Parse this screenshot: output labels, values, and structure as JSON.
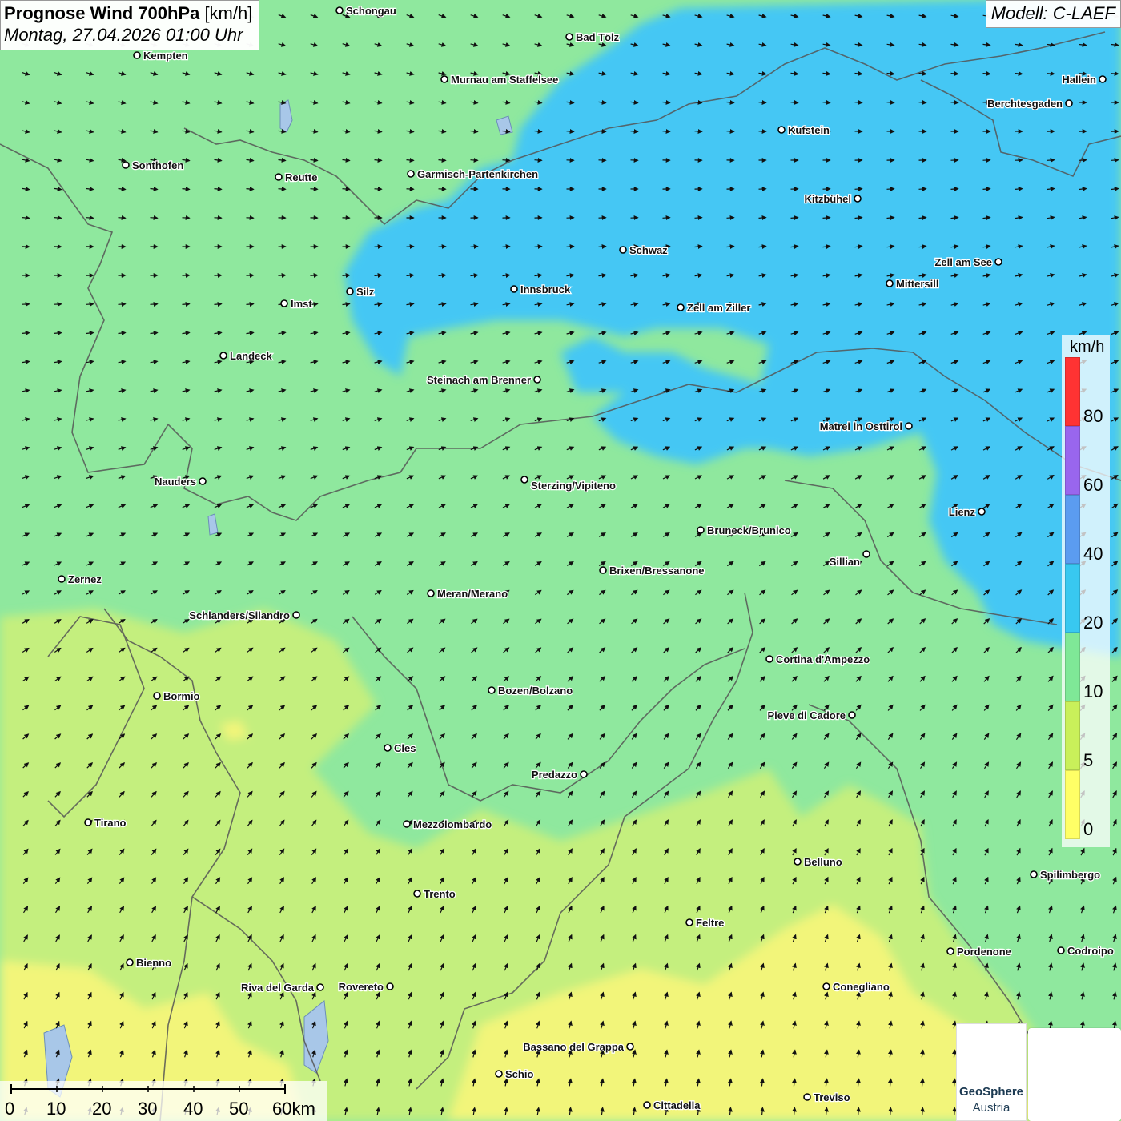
{
  "header": {
    "title_bold": "Prognose Wind 700hPa",
    "title_unit": "[km/h]",
    "datetime": "Montag, 27.04.2026 01:00 Uhr"
  },
  "model_label": "Modell: C-LAEF",
  "legend": {
    "unit": "km/h",
    "labels": [
      "80",
      "60",
      "40",
      "20",
      "10",
      "5",
      "0"
    ],
    "colors": [
      "#ff3333",
      "#9966ee",
      "#5b9cf0",
      "#38c8f0",
      "#7fe897",
      "#c9f05a",
      "#ffff66"
    ]
  },
  "scale": {
    "labels": [
      "0",
      "10",
      "20",
      "30",
      "40",
      "50",
      "60km"
    ]
  },
  "logo": {
    "name1": "GeoSphere",
    "name2": "Austria",
    "icon": "geosphere-logo-icon",
    "app_icon": "wetter-app-icon"
  },
  "places": [
    {
      "name": "Schongau"
    },
    {
      "name": "Bad Tölz"
    },
    {
      "name": "Kempten"
    },
    {
      "name": "Murnau am Staffelsee"
    },
    {
      "name": "Hallein"
    },
    {
      "name": "Berchtesgaden"
    },
    {
      "name": "Kufstein"
    },
    {
      "name": "Sonthofen"
    },
    {
      "name": "Reutte"
    },
    {
      "name": "Garmisch-Partenkirchen"
    },
    {
      "name": "Kitzbühel"
    },
    {
      "name": "Schwaz"
    },
    {
      "name": "Zell am See"
    },
    {
      "name": "Innsbruck"
    },
    {
      "name": "Silz"
    },
    {
      "name": "Mittersill"
    },
    {
      "name": "Imst"
    },
    {
      "name": "Zell am Ziller"
    },
    {
      "name": "Landeck"
    },
    {
      "name": "Steinach am Brenner"
    },
    {
      "name": "Matrei in Osttirol"
    },
    {
      "name": "Nauders"
    },
    {
      "name": "Sterzing/Vipiteno"
    },
    {
      "name": "Lienz"
    },
    {
      "name": "Bruneck/Brunico"
    },
    {
      "name": "Sillian"
    },
    {
      "name": "Brixen/Bressanone"
    },
    {
      "name": "Zernez"
    },
    {
      "name": "Meran/Merano"
    },
    {
      "name": "Schlanders/Silandro"
    },
    {
      "name": "Cortina d'Ampezzo"
    },
    {
      "name": "Bozen/Bolzano"
    },
    {
      "name": "Bormio"
    },
    {
      "name": "Pieve di Cadore"
    },
    {
      "name": "Cles"
    },
    {
      "name": "Predazzo"
    },
    {
      "name": "Tirano"
    },
    {
      "name": "Mezzolombardo"
    },
    {
      "name": "Belluno"
    },
    {
      "name": "Spilimbergo"
    },
    {
      "name": "Trento"
    },
    {
      "name": "Feltre"
    },
    {
      "name": "Bienno"
    },
    {
      "name": "Pordenone"
    },
    {
      "name": "Codroipo"
    },
    {
      "name": "Riva del Garda"
    },
    {
      "name": "Rovereto"
    },
    {
      "name": "Conegliano"
    },
    {
      "name": "Bassano del Grappa"
    },
    {
      "name": "Schio"
    },
    {
      "name": "Treviso"
    },
    {
      "name": "Cittadella"
    }
  ]
}
